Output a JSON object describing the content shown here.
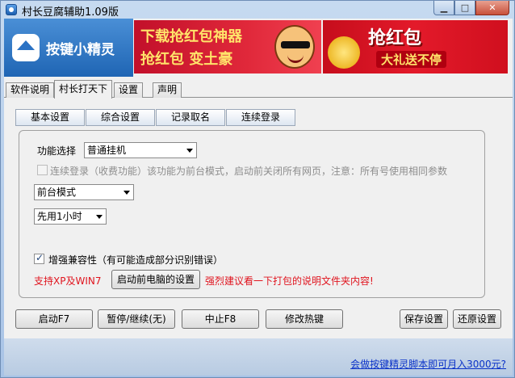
{
  "window": {
    "title": "村长豆腐辅助1.09版",
    "controls": {
      "minimize": "▁",
      "maximize": "□",
      "close": "✕"
    }
  },
  "header": {
    "brand_text": "按键小精灵",
    "ad1": {
      "line1": "下载抢红包神器",
      "line2": "抢红包 变土豪"
    },
    "ad2": {
      "line1": "抢红包",
      "line2": "大礼送不停"
    }
  },
  "tabs": [
    {
      "label": "软件说明"
    },
    {
      "label": "村长打天下",
      "active": true
    },
    {
      "label": "设置"
    },
    {
      "label": "声明"
    }
  ],
  "subtabs": [
    {
      "label": "基本设置"
    },
    {
      "label": "综合设置"
    },
    {
      "label": "记录取名"
    },
    {
      "label": "连续登录"
    }
  ],
  "panel": {
    "function_label": "功能选择",
    "function_value": "普通挂机",
    "continuous_login_text": "连续登录（收费功能）该功能为前台模式，启动前关闭所有网页，注意：所有号使用相同参数",
    "mode_value": "前台模式",
    "duration_value": "先用1小时",
    "compat_text": "增强兼容性（有可能造成部分识别错误）",
    "support_text": "支持XP及WIN7",
    "pc_settings_button": "启动前电脑的设置",
    "warning_text": "强烈建议看一下打包的说明文件夹内容!"
  },
  "buttons": {
    "start": "启动F7",
    "pause": "暂停/继续(无)",
    "stop": "中止F8",
    "hotkey": "修改热键",
    "save": "保存设置",
    "restore": "还原设置"
  },
  "footer": {
    "link_text": "会做按键精灵脚本即可月入3000元?"
  }
}
